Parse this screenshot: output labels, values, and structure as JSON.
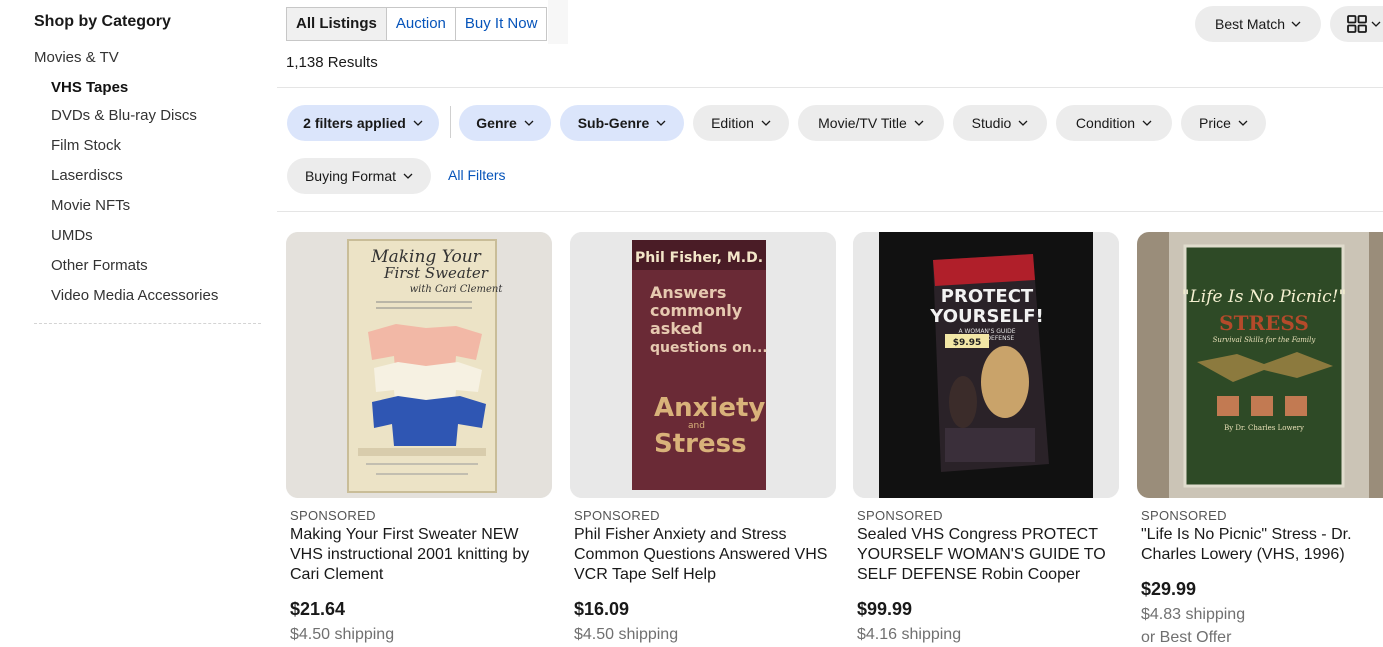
{
  "sidebar": {
    "title": "Shop by Category",
    "parent": "Movies & TV",
    "items": [
      {
        "label": "VHS Tapes",
        "active": true
      },
      {
        "label": "DVDs & Blu-ray Discs"
      },
      {
        "label": "Film Stock"
      },
      {
        "label": "Laserdiscs"
      },
      {
        "label": "Movie NFTs"
      },
      {
        "label": "UMDs"
      },
      {
        "label": "Other Formats"
      },
      {
        "label": "Video Media Accessories"
      }
    ]
  },
  "format_tabs": [
    {
      "label": "All Listings",
      "active": true
    },
    {
      "label": "Auction"
    },
    {
      "label": "Buy It Now"
    }
  ],
  "results_count": "1,138 Results",
  "sort": {
    "label": "Best Match"
  },
  "view_toggle": {
    "icon": "grid-view-icon"
  },
  "filters": {
    "applied": "2 filters applied",
    "genre": "Genre",
    "subgenre": "Sub-Genre",
    "edition": "Edition",
    "movie_title": "Movie/TV Title",
    "studio": "Studio",
    "condition": "Condition",
    "price": "Price",
    "buying_format": "Buying Format",
    "all_filters": "All Filters"
  },
  "listings": [
    {
      "sponsored": "SPONSORED",
      "title": "Making Your First Sweater NEW VHS instructional 2001 knitting by Cari Clement",
      "price": "$21.64",
      "shipping": "$4.50 shipping",
      "image_alt": "Making Your First Sweater with Cari Clement VHS box"
    },
    {
      "sponsored": "SPONSORED",
      "title": "Phil Fisher Anxiety and Stress Common Questions Answered VHS VCR Tape Self Help",
      "price": "$16.09",
      "shipping": "$4.50 shipping",
      "image_alt": "Phil Fisher M.D. Answers commonly asked questions on Anxiety and Stress VHS box"
    },
    {
      "sponsored": "SPONSORED",
      "title": "Sealed VHS Congress PROTECT YOURSELF WOMAN'S GUIDE TO SELF DEFENSE Robin Cooper",
      "price": "$99.99",
      "shipping": "$4.16 shipping",
      "image_alt": "Protect Yourself! A Woman's Guide to Self Defense VHS box"
    },
    {
      "sponsored": "SPONSORED",
      "title": "\"Life Is No Picnic\" Stress - Dr. Charles Lowery (VHS, 1996)",
      "price": "$29.99",
      "shipping": "$4.83 shipping",
      "best_offer": "or Best Offer",
      "image_alt": "Life Is No Picnic Stress VHS case"
    }
  ],
  "image_text": {
    "making": [
      "Making Your",
      "First Sweater",
      "with Cari Clement"
    ],
    "phil": [
      "Phil Fisher, M.D.",
      "Answers",
      "commonly",
      "asked",
      "questions on...",
      "Anxiety",
      "and",
      "Stress"
    ],
    "protect": [
      "PROTECT",
      "YOURSELF!",
      "A WOMAN'S GUIDE",
      "TO SELF DEFENSE",
      "$9.95"
    ],
    "picnic": [
      "\"Life Is No Picnic!\"",
      "STRESS",
      "Survival Skills for the Family",
      "By Dr. Charles Lowery"
    ]
  },
  "colors": {
    "link": "#0654ba",
    "pill_selected": "#dbe5fb",
    "pill": "#ececec"
  }
}
